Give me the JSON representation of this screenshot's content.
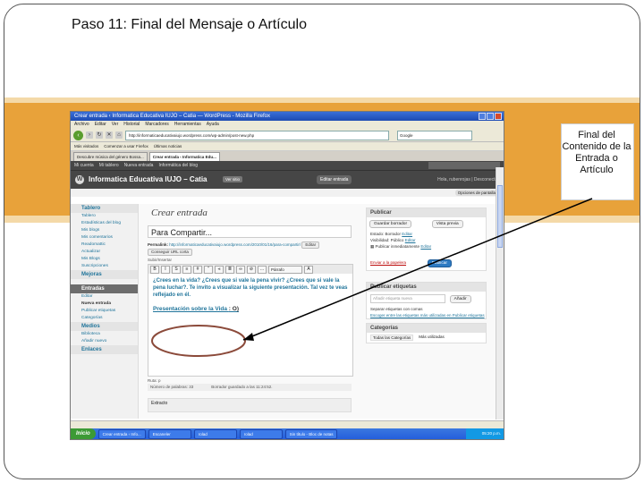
{
  "slide": {
    "title": "Paso 11: Final del Mensaje o Artículo",
    "callout": "Final del Contenido de la Entrada o Artículo"
  },
  "browser": {
    "window_title": "Crear entrada ‹ Informatica Educativa IUJO – Catia — WordPress - Mozilla Firefox",
    "menu": [
      "Archivo",
      "Editar",
      "Ver",
      "Historial",
      "Marcadores",
      "Herramientas",
      "Ayuda"
    ],
    "url": "http://informaticaeducativaiujo.wordpress.com/wp-admin/post-new.php",
    "search_placeholder": "Google",
    "bookmarks": [
      "Más visitados",
      "Comenzar a usar Firefox",
      "Últimas noticias"
    ],
    "tabs": [
      "Descubre música del género Bossa...",
      "Crear entrada ‹ Informatica Edu..."
    ]
  },
  "wp": {
    "adminbar": [
      "Mi cuenta",
      "Mi tablero",
      "Nueva entrada",
      "Informática del blog"
    ],
    "site_title": "Informatica Educativa IUJO – Catia",
    "visit_site": "Ver sitio",
    "draft_button": "Editar entrada",
    "user": "Hola, rubenrojas | Desconectar",
    "screen_options": "Opciones de pantalla",
    "sidebar": {
      "sections": [
        {
          "label": "Tablero",
          "items": [
            "Tablero",
            "Estadísticas del blog",
            "Mis blogs",
            "Mis comentarios",
            "Readomattic",
            "Actualizar",
            "Mis Blogs",
            "Suscripciones"
          ]
        },
        {
          "label": "Mejoras",
          "items": []
        },
        {
          "label": "Entradas",
          "items": [
            "Editar",
            "Nueva entrada",
            "Publicar etiquetas",
            "Categorías"
          ]
        },
        {
          "label": "Medios",
          "items": [
            "Biblioteca",
            "Añadir nuevo"
          ]
        },
        {
          "label": "Enlaces",
          "items": []
        }
      ]
    },
    "page_title": "Crear entrada",
    "post_title": "Para Compartir...",
    "permalink_label": "Permalink:",
    "permalink_url": "http://informaticaeducativaiujo.wordpress.com/2010/01/16/para-compartir/",
    "permalink_buttons": [
      "Editar",
      "Conseguir URL corta"
    ],
    "upload_label": "Subir/Insertar",
    "toolbar_format": "Párrafo",
    "editor_paragraph": "¿Crees en la vida? ¿Crees que si vale la pena vivir? ¿Crees que si vale la pena luchar?. Te invito a visualizar la siguiente presentación. Tal vez te veas reflejado en él.",
    "editor_link": "Presentación sobre la Vida",
    "editor_smile": ": O)",
    "path_label": "Ruta: p",
    "word_count": "Número de palabras: 33",
    "draft_saved": "Borrador guardado a las 11:24:52.",
    "excerpt_label": "Extracto",
    "publish": {
      "header": "Publicar",
      "save_draft": "Guardar borrador",
      "preview": "Vista previa",
      "status": "Estado: Borrador",
      "status_edit": "Editar",
      "visibility": "Visibilidad: Público",
      "visibility_edit": "Editar",
      "schedule": "Publicar inmediatamente",
      "schedule_edit": "Editar",
      "trash": "Enviar a la papelera",
      "publish_button": "Publicar"
    },
    "tags": {
      "header": "Publicar etiquetas",
      "placeholder": "Añadir etiqueta nueva",
      "add_button": "Añadir",
      "hint": "Separar etiquetas con comas",
      "choose": "Escoger entre las etiquetas más utilizadas en Publicar etiquetas"
    },
    "categories": {
      "header": "Categorías",
      "tab_all": "Todas las Categorías",
      "tab_used": "Más utilizadas"
    }
  },
  "taskbar": {
    "start": "Inicio",
    "tasks": [
      "Crear entrada ‹ Info...",
      "Escaneler",
      "rolad",
      "rolad",
      "Sin título - Bloc de notas"
    ],
    "clock": "05:20 p.m."
  },
  "colors": {
    "band": "#e8a23a",
    "arrow": "#000000",
    "ellipse": "#8b4a3a"
  }
}
